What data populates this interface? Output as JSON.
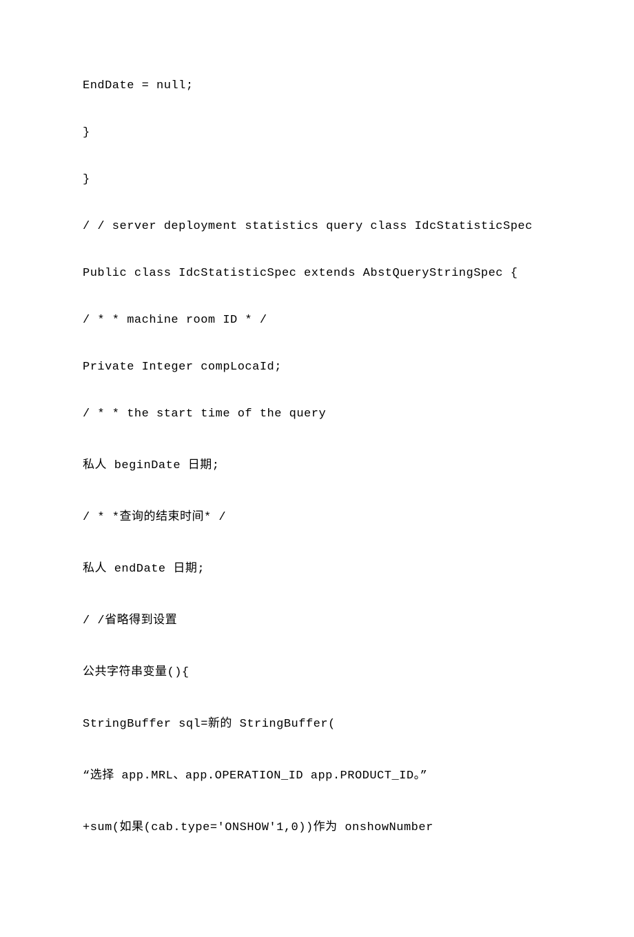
{
  "lines": [
    "EndDate = null;",
    "}",
    "}",
    "/ / server deployment statistics query class IdcStatisticSpec",
    "Public class IdcStatisticSpec extends AbstQueryStringSpec {",
    "/ * * machine room ID * /",
    "Private Integer compLocaId;",
    "/ * * the start time of the query",
    "私人 beginDate 日期;",
    "/ * *查询的结束时间* /",
    "私人 endDate 日期;",
    "/ /省略得到设置",
    "公共字符串变量(){",
    "StringBuffer sql=新的 StringBuffer(",
    "“选择 app.MRL、app.OPERATION_ID app.PRODUCT_ID。”",
    "+sum(如果(cab.type='ONSHOW'1,0))作为 onshowNumber"
  ]
}
